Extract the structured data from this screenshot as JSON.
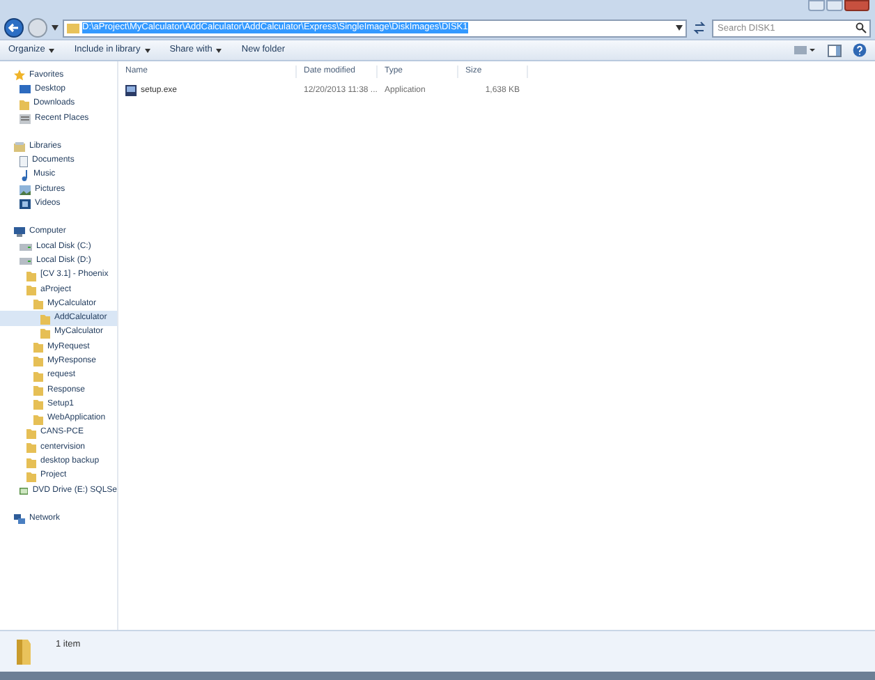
{
  "address_bar": {
    "path": "D:\\aProject\\MyCalculator\\AddCalculator\\AddCalculator\\Express\\SingleImage\\DiskImages\\DISK1"
  },
  "search": {
    "placeholder": "Search DISK1"
  },
  "toolbar": [
    {
      "label": "Organize",
      "dropdown": true
    },
    {
      "label": "Include in library",
      "dropdown": true
    },
    {
      "label": "Share with",
      "dropdown": true
    },
    {
      "label": "New folder",
      "dropdown": false
    }
  ],
  "navigation": [
    {
      "label": "Favorites",
      "kind": "favorites",
      "items": [
        {
          "label": "Desktop",
          "kind": "desktop",
          "selected": false
        },
        {
          "label": "Downloads",
          "kind": "folder",
          "selected": false
        },
        {
          "label": "Recent Places",
          "kind": "recent",
          "selected": false
        }
      ]
    },
    {
      "label": "Libraries",
      "kind": "libraries",
      "items": [
        {
          "label": "Documents",
          "kind": "document",
          "selected": false
        },
        {
          "label": "Music",
          "kind": "music",
          "selected": false
        },
        {
          "label": "Pictures",
          "kind": "pictures",
          "selected": false
        },
        {
          "label": "Videos",
          "kind": "videos",
          "selected": false
        }
      ]
    },
    {
      "label": "Computer",
      "kind": "computer",
      "items": [
        {
          "label": "Local Disk (C:)",
          "kind": "drive",
          "selected": false
        },
        {
          "label": "Local Disk (D:)",
          "kind": "drive",
          "selected": false,
          "children": [
            {
              "label": "[CV 3.1] - Phoenix",
              "kind": "folder",
              "selected": false
            },
            {
              "label": "aProject",
              "kind": "folder",
              "selected": false,
              "children": [
                {
                  "label": "MyCalculator",
                  "kind": "folder",
                  "selected": false,
                  "children": [
                    {
                      "label": "AddCalculator",
                      "kind": "folder",
                      "selected": true
                    },
                    {
                      "label": "MyCalculator",
                      "kind": "folder",
                      "selected": false
                    }
                  ]
                },
                {
                  "label": "MyRequest",
                  "kind": "folder",
                  "selected": false
                },
                {
                  "label": "MyResponse",
                  "kind": "folder",
                  "selected": false
                },
                {
                  "label": "request",
                  "kind": "folder",
                  "selected": false
                },
                {
                  "label": "Response",
                  "kind": "folder",
                  "selected": false
                },
                {
                  "label": "Setup1",
                  "kind": "folder",
                  "selected": false
                },
                {
                  "label": "WebApplication",
                  "kind": "folder",
                  "selected": false
                }
              ]
            },
            {
              "label": "CANS-PCE",
              "kind": "folder",
              "selected": false
            },
            {
              "label": "centervision",
              "kind": "folder",
              "selected": false
            },
            {
              "label": "desktop backup",
              "kind": "folder",
              "selected": false
            },
            {
              "label": "Project",
              "kind": "folder",
              "selected": false
            }
          ]
        },
        {
          "label": "DVD Drive (E:) SQLSe",
          "kind": "dvd",
          "selected": false
        }
      ]
    },
    {
      "label": "Network",
      "kind": "network"
    }
  ],
  "table": {
    "columns": [
      "Name",
      "Date modified",
      "Type",
      "Size"
    ],
    "rows": [
      {
        "name": "setup.exe",
        "date_modified": "12/20/2013 11:38 ...",
        "type": "Application",
        "size": "1,638 KB"
      }
    ]
  },
  "status_bar": {
    "count": "1 item"
  }
}
